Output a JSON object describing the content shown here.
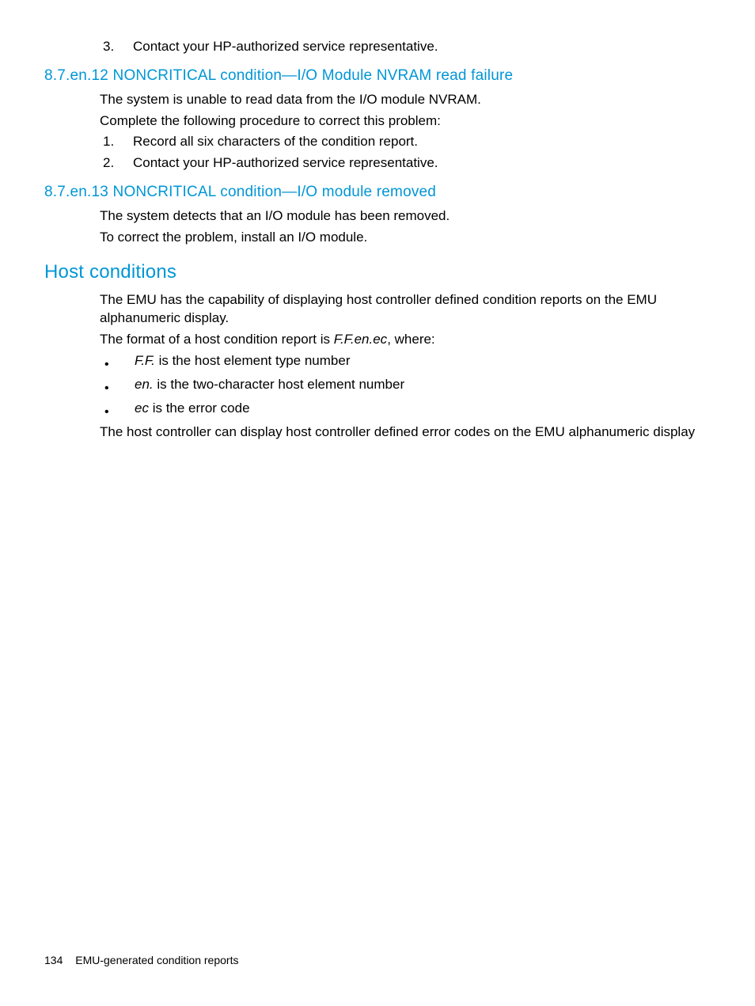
{
  "top_list": {
    "items": [
      {
        "num": "3.",
        "text": "Contact your HP-authorized service representative."
      }
    ]
  },
  "sec12": {
    "heading": "8.7.en.12 NONCRITICAL condition—I/O Module NVRAM read failure",
    "p1": "The system is unable to read data from the I/O module NVRAM.",
    "p2": "Complete the following procedure to correct this problem:",
    "steps": [
      {
        "num": "1.",
        "text": "Record all six characters of the condition report."
      },
      {
        "num": "2.",
        "text": "Contact your HP-authorized service representative."
      }
    ]
  },
  "sec13": {
    "heading": "8.7.en.13 NONCRITICAL condition—I/O module removed",
    "p1": "The system detects that an I/O module has been removed.",
    "p2": "To correct the problem, install an I/O module."
  },
  "host": {
    "heading": "Host conditions",
    "p1": "The EMU has the capability of displaying host controller defined condition reports on the EMU alphanumeric display.",
    "p2_pre": "The format of a host condition report is ",
    "p2_em": "F.F.en.ec",
    "p2_post": ", where:",
    "bullets": [
      {
        "em": "F.F.",
        "rest": " is the host element type number"
      },
      {
        "em": "en.",
        "rest": " is the two-character host element number"
      },
      {
        "em": "ec",
        "rest": " is the error code"
      }
    ],
    "p3": "The host controller can display host controller defined error codes on the EMU alphanumeric display"
  },
  "footer": {
    "page_number": "134",
    "title": "EMU-generated condition reports"
  }
}
